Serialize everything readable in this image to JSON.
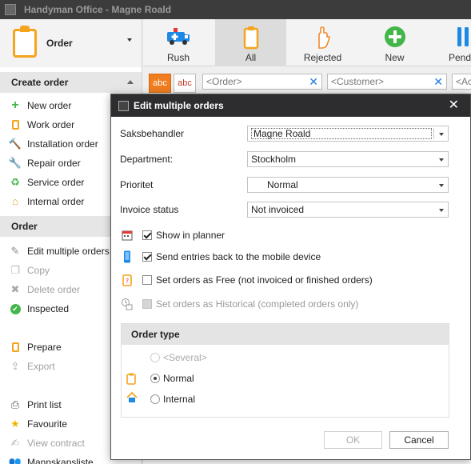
{
  "window": {
    "title": "Handyman Office - Magne Roald"
  },
  "module": {
    "label": "Order",
    "icon": "clipboard-icon"
  },
  "toolbar": {
    "buttons": [
      {
        "label": "Rush",
        "icon": "ambulance-icon"
      },
      {
        "label": "All",
        "icon": "clipboard-icon"
      },
      {
        "label": "Rejected",
        "icon": "raised-hand-icon"
      },
      {
        "label": "New",
        "icon": "plus-circle-icon"
      },
      {
        "label": "Pend",
        "icon": "pause-icon"
      }
    ]
  },
  "filters": {
    "abc1": "abc",
    "abc2": "abc",
    "order_placeholder": "<Order>",
    "customer_placeholder": "<Customer>",
    "third_placeholder": "<Ac"
  },
  "sidebar": {
    "create_header": "Create order",
    "create_items": [
      {
        "label": "New order",
        "icon": "plus-icon"
      },
      {
        "label": "Work order",
        "icon": "clipboard-icon"
      },
      {
        "label": "Installation order",
        "icon": "hammer-icon"
      },
      {
        "label": "Repair order",
        "icon": "wrench-icon"
      },
      {
        "label": "Service order",
        "icon": "recycle-icon"
      },
      {
        "label": "Internal order",
        "icon": "house-icon"
      }
    ],
    "order_header": "Order",
    "order_items": [
      {
        "label": "Edit multiple orders",
        "icon": "edit-icon"
      },
      {
        "label": "Copy",
        "icon": "copy-icon"
      },
      {
        "label": "Delete order",
        "icon": "delete-icon"
      },
      {
        "label": "Inspected",
        "icon": "check-circle-icon"
      },
      {
        "label": "Prepare",
        "icon": "clipboard-icon"
      },
      {
        "label": "Export",
        "icon": "export-icon"
      },
      {
        "label": "Print list",
        "icon": "printer-icon"
      },
      {
        "label": "Favourite",
        "icon": "star-icon"
      },
      {
        "label": "View contract",
        "icon": "contract-icon"
      },
      {
        "label": "Mannskapsliste",
        "icon": "people-icon"
      }
    ]
  },
  "dialog": {
    "title": "Edit multiple orders",
    "fields": {
      "saksbehandler": {
        "label": "Saksbehandler",
        "value": "Magne Roald"
      },
      "department": {
        "label": "Department:",
        "value": "Stockholm"
      },
      "prioritet": {
        "label": "Prioritet",
        "value": "Normal"
      },
      "invoice_status": {
        "label": "Invoice status",
        "value": "Not invoiced"
      }
    },
    "checks": {
      "show_in_planner": {
        "label": "Show in planner",
        "checked": true
      },
      "send_entries": {
        "label": "Send entries back to the mobile device",
        "checked": true
      },
      "set_free": {
        "label": "Set orders as Free (not invoiced or finished orders)",
        "checked": false
      },
      "set_historical": {
        "label": "Set orders as Historical (completed orders only)",
        "checked": false
      }
    },
    "order_type": {
      "header": "Order type",
      "options": [
        {
          "label": "<Several>",
          "selected": false
        },
        {
          "label": "Normal",
          "selected": true
        },
        {
          "label": "Internal",
          "selected": false
        }
      ]
    },
    "ok_label": "OK",
    "cancel_label": "Cancel"
  }
}
